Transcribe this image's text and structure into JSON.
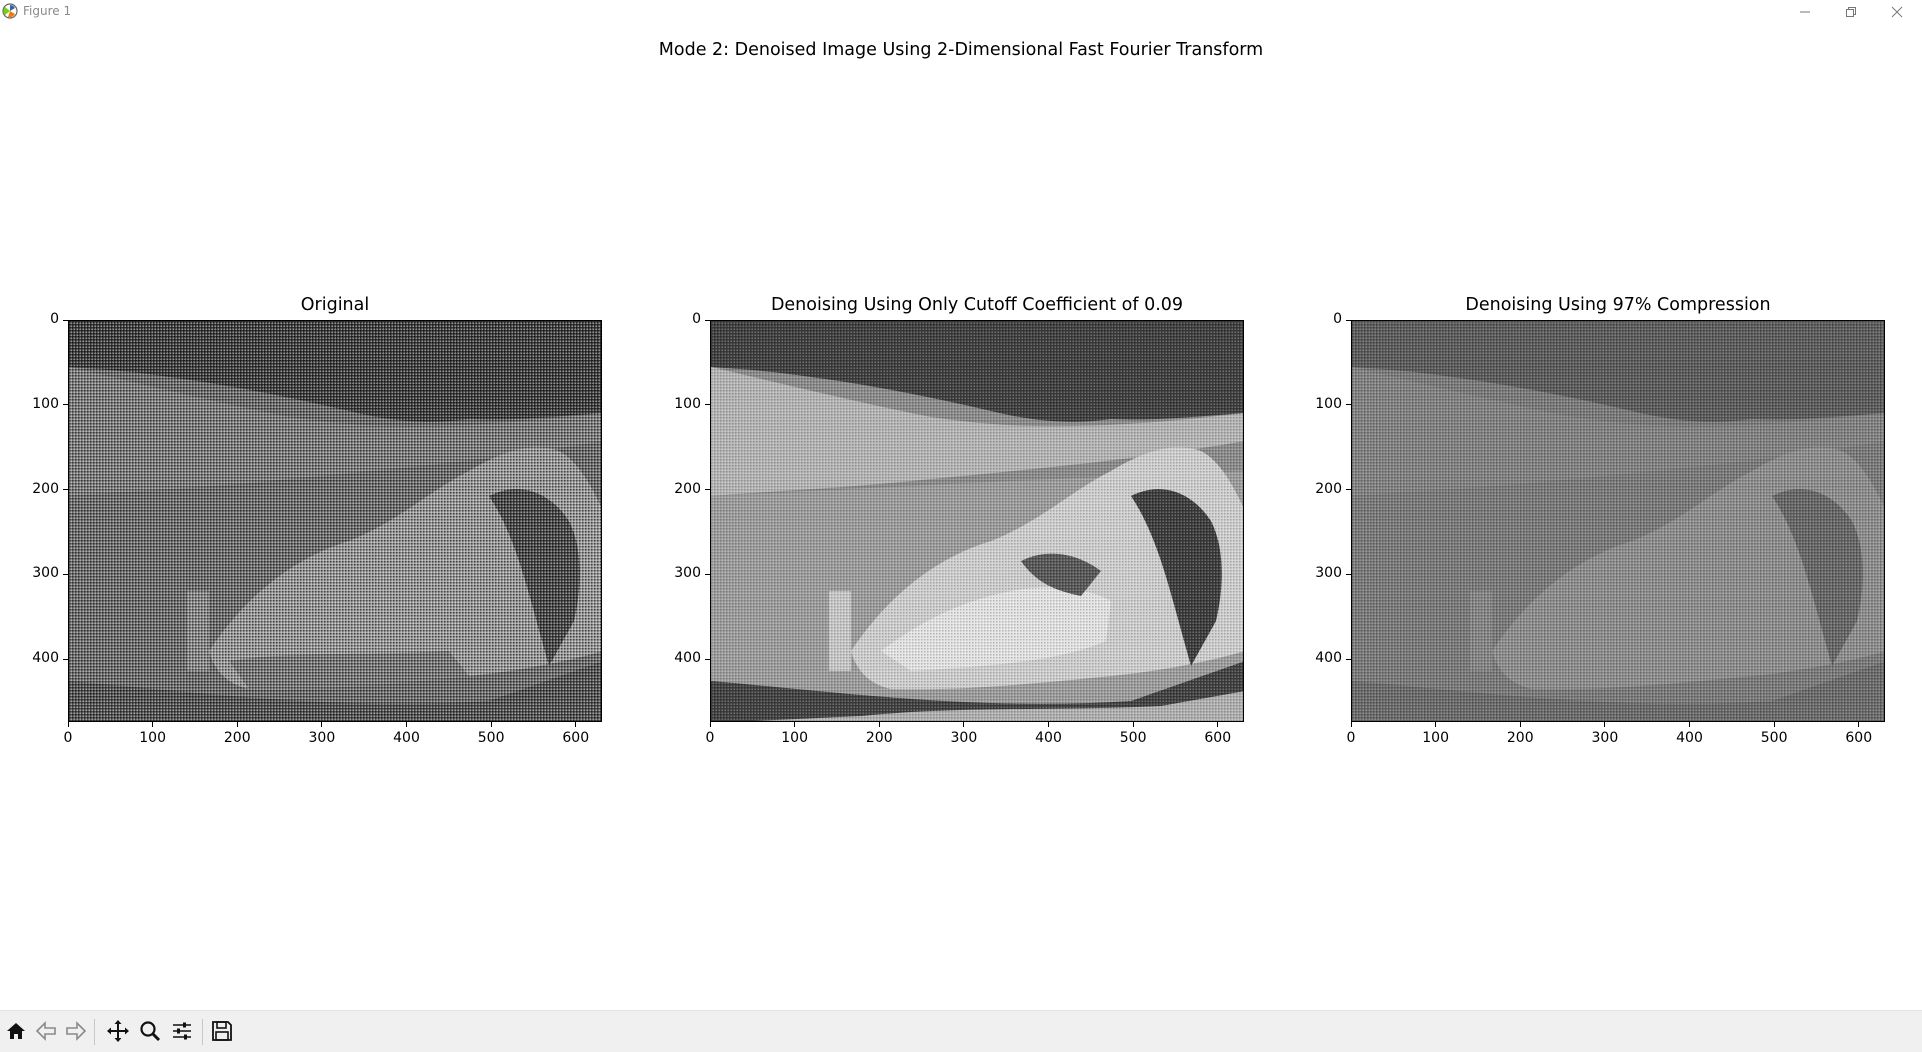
{
  "window": {
    "title": "Figure 1",
    "controls": {
      "minimize": "minimize-icon",
      "maximize": "restore-icon",
      "close": "close-icon"
    }
  },
  "figure": {
    "suptitle": "Mode 2: Denoised Image Using 2-Dimensional Fast Fourier Transform"
  },
  "panels": [
    {
      "title": "Original",
      "xticks": [
        "0",
        "100",
        "200",
        "300",
        "400",
        "500",
        "600"
      ],
      "yticks": [
        "0",
        "100",
        "200",
        "300",
        "400"
      ],
      "style": "noisy"
    },
    {
      "title": "Denoising Using Only Cutoff Coefficient of 0.09",
      "xticks": [
        "0",
        "100",
        "200",
        "300",
        "400",
        "500",
        "600"
      ],
      "yticks": [
        "0",
        "100",
        "200",
        "300",
        "400"
      ],
      "style": "contrast"
    },
    {
      "title": "Denoising Using 97% Compression",
      "xticks": [
        "0",
        "100",
        "200",
        "300",
        "400",
        "500",
        "600"
      ],
      "yticks": [
        "0",
        "100",
        "200",
        "300",
        "400"
      ],
      "style": "flat"
    }
  ],
  "toolbar": {
    "buttons": [
      "home-icon",
      "back-icon",
      "forward-icon",
      "pan-icon",
      "zoom-icon",
      "configure-subplots-icon",
      "save-icon"
    ]
  },
  "colors": {
    "accent": "#000000",
    "toolbar_bg": "#f0f0f0"
  }
}
